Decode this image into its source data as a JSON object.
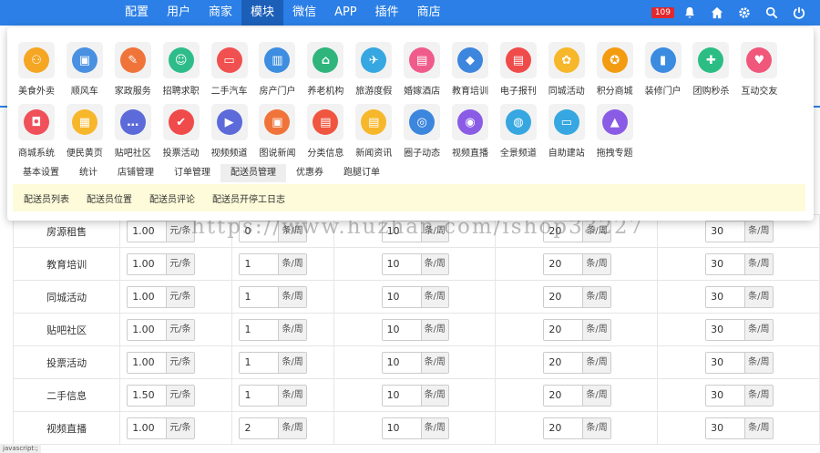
{
  "nav": {
    "items": [
      "配置",
      "用户",
      "商家",
      "模块",
      "微信",
      "APP",
      "插件",
      "商店"
    ],
    "active_index": 3
  },
  "top_right": {
    "badge": "109",
    "icons": [
      "bell-icon",
      "home-icon",
      "gear-icon",
      "search-icon",
      "power-icon"
    ]
  },
  "colors": {
    "topbar": "#2b7fe6",
    "active_nav": "#1c5fb8",
    "highlight_bar": "#fdfbd9"
  },
  "modules": [
    {
      "label": "美食外卖",
      "color": "#f5a623",
      "glyph": "⚇"
    },
    {
      "label": "顺风车",
      "color": "#4a90e2",
      "glyph": "▣"
    },
    {
      "label": "家政服务",
      "color": "#f0743a",
      "glyph": "✎"
    },
    {
      "label": "招聘求职",
      "color": "#2ebd8a",
      "glyph": "☺"
    },
    {
      "label": "二手汽车",
      "color": "#f0504f",
      "glyph": "▭"
    },
    {
      "label": "房产门户",
      "color": "#3d8de0",
      "glyph": "▥"
    },
    {
      "label": "养老机构",
      "color": "#2fb57c",
      "glyph": "⌂"
    },
    {
      "label": "旅游度假",
      "color": "#36a7e0",
      "glyph": "✈"
    },
    {
      "label": "婚嫁酒店",
      "color": "#ef5c8b",
      "glyph": "▤"
    },
    {
      "label": "教育培训",
      "color": "#3d86de",
      "glyph": "◆"
    },
    {
      "label": "电子报刊",
      "color": "#ef4b4b",
      "glyph": "▤"
    },
    {
      "label": "同城活动",
      "color": "#f7b72a",
      "glyph": "✿"
    },
    {
      "label": "积分商城",
      "color": "#f39c12",
      "glyph": "✪"
    },
    {
      "label": "装修门户",
      "color": "#3b8be0",
      "glyph": "▮"
    },
    {
      "label": "团购秒杀",
      "color": "#2bbd84",
      "glyph": "✚"
    },
    {
      "label": "互动交友",
      "color": "#f0577a",
      "glyph": "♥"
    },
    {
      "label": "商城系统",
      "color": "#f0505a",
      "glyph": "◘"
    },
    {
      "label": "便民黄页",
      "color": "#f7b72a",
      "glyph": "▦"
    },
    {
      "label": "贴吧社区",
      "color": "#5c6bd9",
      "glyph": "…"
    },
    {
      "label": "投票活动",
      "color": "#ef4b4b",
      "glyph": "✔"
    },
    {
      "label": "视频频道",
      "color": "#5c6bd9",
      "glyph": "▶"
    },
    {
      "label": "图说新闻",
      "color": "#f0743a",
      "glyph": "▣"
    },
    {
      "label": "分类信息",
      "color": "#f0553f",
      "glyph": "▤"
    },
    {
      "label": "新闻资讯",
      "color": "#f7b72a",
      "glyph": "▤"
    },
    {
      "label": "圈子动态",
      "color": "#3d86de",
      "glyph": "◎"
    },
    {
      "label": "视频直播",
      "color": "#8a5ce6",
      "glyph": "◉"
    },
    {
      "label": "全景频道",
      "color": "#36a7e0",
      "glyph": "◍"
    },
    {
      "label": "自助建站",
      "color": "#36a7e0",
      "glyph": "▭"
    },
    {
      "label": "拖拽专题",
      "color": "#8a5ce6",
      "glyph": "▲"
    }
  ],
  "sub_tabs": [
    "基本设置",
    "统计",
    "店铺管理",
    "订单管理",
    "配送员管理",
    "优惠券",
    "跑腿订单"
  ],
  "sub_tab_active_index": 4,
  "sub_links": [
    "配送员列表",
    "配送员位置",
    "配送员评论",
    "配送员开停工日志"
  ],
  "table": {
    "rows": [
      {
        "name": "房源租售",
        "price": "1.00",
        "price_unit": "元/条",
        "v1": "0",
        "v2": "10",
        "v3": "20",
        "v4": "30",
        "unit": "条/周"
      },
      {
        "name": "教育培训",
        "price": "1.00",
        "price_unit": "元/条",
        "v1": "1",
        "v2": "10",
        "v3": "20",
        "v4": "30",
        "unit": "条/周"
      },
      {
        "name": "同城活动",
        "price": "1.00",
        "price_unit": "元/条",
        "v1": "1",
        "v2": "10",
        "v3": "20",
        "v4": "30",
        "unit": "条/周"
      },
      {
        "name": "贴吧社区",
        "price": "1.00",
        "price_unit": "元/条",
        "v1": "1",
        "v2": "10",
        "v3": "20",
        "v4": "30",
        "unit": "条/周"
      },
      {
        "name": "投票活动",
        "price": "1.00",
        "price_unit": "元/条",
        "v1": "1",
        "v2": "10",
        "v3": "20",
        "v4": "30",
        "unit": "条/周"
      },
      {
        "name": "二手信息",
        "price": "1.50",
        "price_unit": "元/条",
        "v1": "1",
        "v2": "10",
        "v3": "20",
        "v4": "30",
        "unit": "条/周"
      },
      {
        "name": "视频直播",
        "price": "1.00",
        "price_unit": "元/条",
        "v1": "2",
        "v2": "10",
        "v3": "20",
        "v4": "30",
        "unit": "条/周"
      }
    ]
  },
  "watermark": "https://www.huzhan.com/ishop33227",
  "status": "javascript:;"
}
